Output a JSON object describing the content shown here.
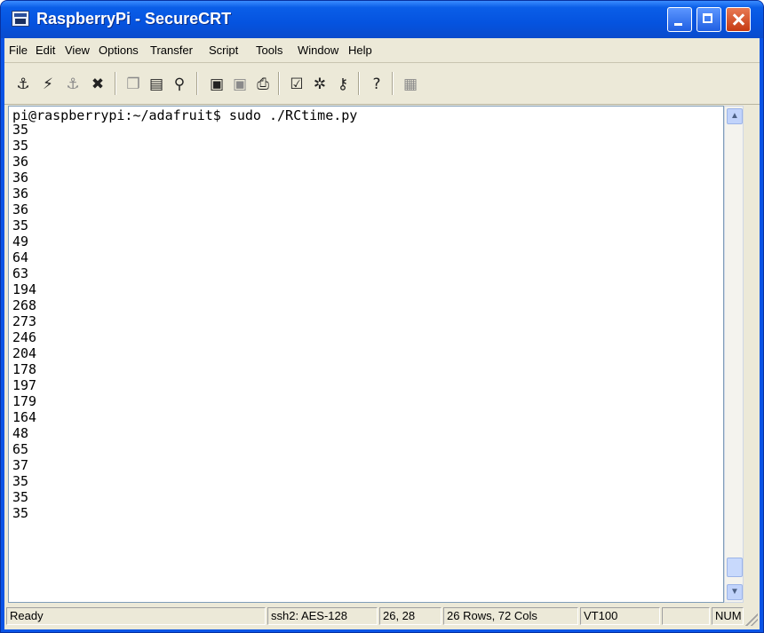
{
  "window": {
    "title": "RaspberryPi - SecureCRT"
  },
  "menu": {
    "file": "File",
    "edit": "Edit",
    "view": "View",
    "options": "Options",
    "transfer": "Transfer",
    "script": "Script",
    "tools": "Tools",
    "window": "Window",
    "help": "Help"
  },
  "toolbar": {
    "icons": [
      "connect-icon",
      "quick-connect-icon",
      "connect-tab-icon",
      "disconnect-icon",
      "copy-icon",
      "paste-icon",
      "find-icon",
      "print-screen-icon",
      "print-selection-icon",
      "print-icon",
      "session-options-icon",
      "global-options-icon",
      "keymap-icon",
      "help-icon",
      "sftp-icon"
    ]
  },
  "terminal": {
    "prompt_line": "pi@raspberrypi:~/adafruit$ sudo ./RCtime.py",
    "output": [
      "35",
      "35",
      "36",
      "36",
      "36",
      "36",
      "35",
      "49",
      "64",
      "63",
      "194",
      "268",
      "273",
      "246",
      "204",
      "178",
      "197",
      "179",
      "164",
      "48",
      "65",
      "37",
      "35",
      "35",
      "35"
    ]
  },
  "status": {
    "ready": "Ready",
    "encryption": "ssh2: AES-128",
    "cursor": "26,  28",
    "size": "26 Rows, 72 Cols",
    "emulation": "VT100",
    "blank": "",
    "num": "NUM"
  }
}
